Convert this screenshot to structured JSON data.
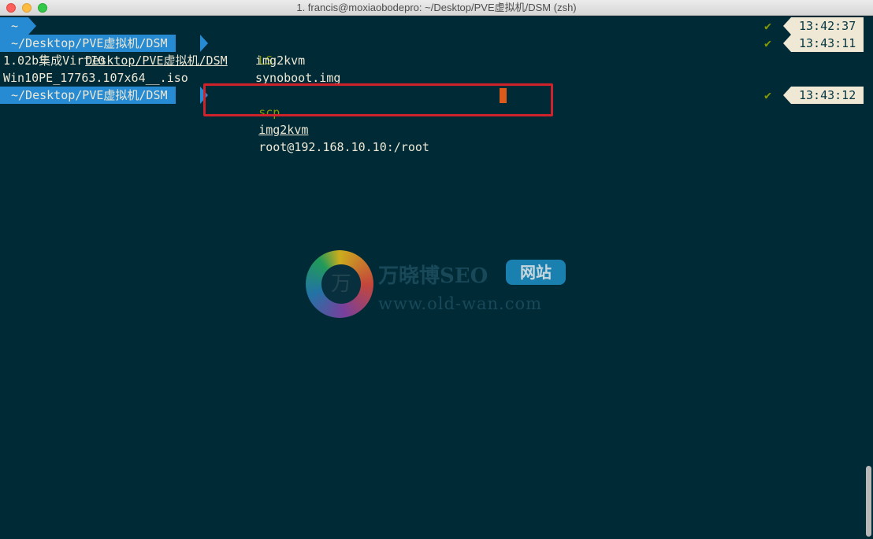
{
  "window": {
    "title": "1. francis@moxiaobodepro: ~/Desktop/PVE虚拟机/DSM (zsh)",
    "accent_colors": {
      "background": "#002b36",
      "prompt": "#268bd2",
      "command": "#859900",
      "time_bg": "#eee8d5",
      "cursor": "#dc5a1a",
      "highlight": "#d0222a"
    }
  },
  "lines": [
    {
      "home": "~",
      "cmd_exe": "cd",
      "cmd_arg": "Desktop/PVE虚拟机/DSM",
      "check": "✔",
      "time": "13:42:37"
    },
    {
      "path": "~/Desktop/PVE虚拟机/DSM",
      "cmd_exe": "LS",
      "check": "✔",
      "time": "13:43:11"
    },
    {
      "col1": "1.02b集成VirtIO",
      "col2": "img2kvm"
    },
    {
      "col1": "Win10PE_17763.107x64__.iso",
      "col2": "synoboot.img"
    },
    {
      "path": "~/Desktop/PVE虚拟机/DSM",
      "cmd_exe": "scp",
      "cmd_arg": "img2kvm",
      "cmd_rest": "root@192.168.10.10:/root",
      "check": "✔",
      "time": "13:43:12"
    }
  ],
  "watermark": {
    "logo_char": "万",
    "name": "万晓博SEO",
    "badge": "网站",
    "url": "www.old-wan.com"
  }
}
